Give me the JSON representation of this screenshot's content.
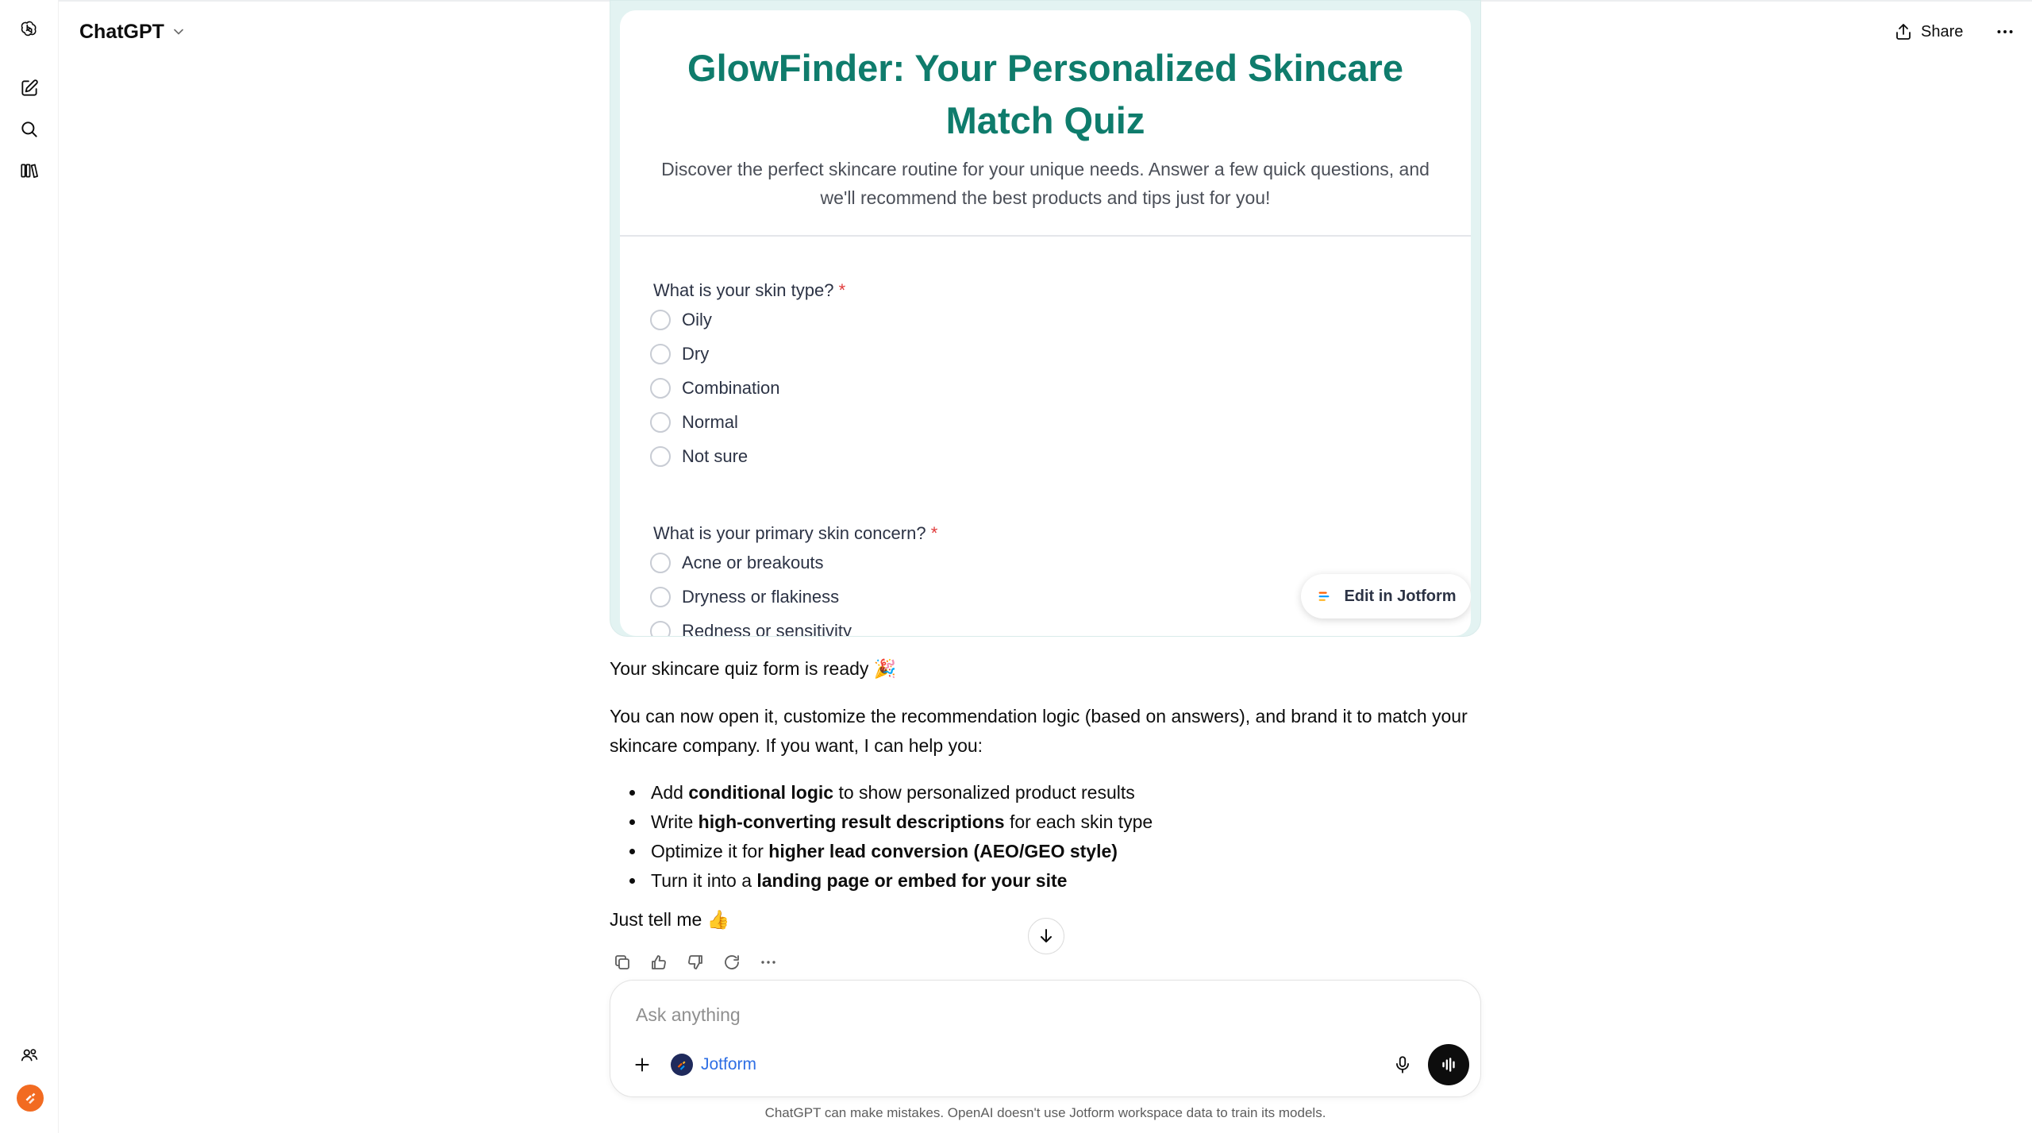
{
  "header": {
    "model_name": "ChatGPT",
    "share_label": "Share"
  },
  "sidebar": {
    "items": [
      "openai-logo-icon",
      "new-chat-icon",
      "search-icon",
      "library-icon",
      "group-chat-icon",
      "profile-avatar"
    ]
  },
  "form": {
    "title": "GlowFinder: Your Personalized Skincare Match Quiz",
    "description": "Discover the perfect skincare routine for your unique needs. Answer a few quick questions, and we'll recommend the best products and tips just for you!",
    "required_mark": "*",
    "q1": {
      "label": "What is your skin type?",
      "options": [
        "Oily",
        "Dry",
        "Combination",
        "Normal",
        "Not sure"
      ]
    },
    "q2": {
      "label": "What is your primary skin concern?",
      "options": [
        "Acne or breakouts",
        "Dryness or flakiness",
        "Redness or sensitivity"
      ]
    },
    "edit_button": "Edit in Jotform"
  },
  "message": {
    "ready_line": "Your skincare quiz form is ready 🎉",
    "intro": "You can now open it, customize the recommendation logic (based on answers), and brand it to match your skincare company. If you want, I can help you:",
    "bullets": [
      {
        "pre": "Add ",
        "bold": "conditional logic",
        "post": " to show personalized product results"
      },
      {
        "pre": "Write ",
        "bold": "high-converting result descriptions",
        "post": " for each skin type"
      },
      {
        "pre": "Optimize it for ",
        "bold": "higher lead conversion (AEO/GEO style)",
        "post": ""
      },
      {
        "pre": "Turn it into a ",
        "bold": "landing page or embed for your site",
        "post": ""
      }
    ],
    "closing": "Just tell me 👍"
  },
  "composer": {
    "placeholder": "Ask anything",
    "tool_chip": "Jotform"
  },
  "footer": {
    "disclaimer": "ChatGPT can make mistakes. OpenAI doesn't use Jotform workspace data to train its models."
  },
  "colors": {
    "form_title": "#0f7c6c",
    "form_frame": "#e3f3f2",
    "required": "#e03a3a",
    "tool_chip_text": "#2f6fe4",
    "avatar": "#f26b21"
  }
}
